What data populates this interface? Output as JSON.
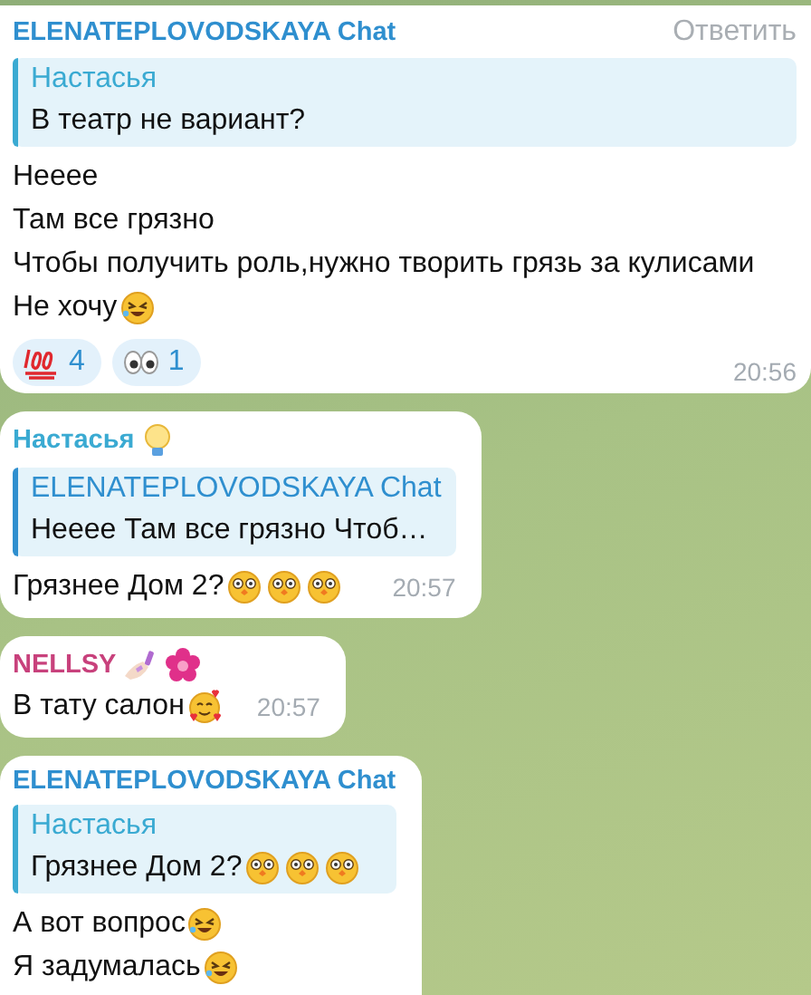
{
  "messages": [
    {
      "sender": "ELENATEPLOVODSKAYA Chat",
      "color": "#2f8fcf",
      "action": "Ответить",
      "quote": {
        "author": "Настасья",
        "color": "#3aaad2",
        "text": "В театр не вариант?"
      },
      "lines": [
        {
          "text": "Нееее"
        },
        {
          "text": "Там все грязно"
        },
        {
          "text": "Чтобы получить роль,нужно творить грязь за кулисами"
        },
        {
          "text": "Не хочу",
          "emoji": [
            {
              "kind": "rofl"
            }
          ]
        }
      ],
      "reactions": [
        {
          "kind": "hundred",
          "count": "4"
        },
        {
          "kind": "eyes",
          "count": "1"
        }
      ],
      "time": "20:56"
    },
    {
      "sender": "Настасья",
      "color": "#3aaad2",
      "badges": [
        {
          "kind": "bulb"
        }
      ],
      "quote": {
        "author": "ELENATEPLOVODSKAYA Chat",
        "color": "#2f8fcf",
        "text": "Нееее Там все грязно Чтоб…"
      },
      "lines": [
        {
          "text": "Грязнее Дом 2?",
          "emoji": [
            {
              "kind": "flushed"
            },
            {
              "kind": "flushed"
            },
            {
              "kind": "flushed"
            }
          ]
        }
      ],
      "time": "20:57"
    },
    {
      "sender": "NELLSY",
      "color": "#c8417c",
      "badges": [
        {
          "kind": "nail-polish"
        },
        {
          "kind": "flower"
        }
      ],
      "lines": [
        {
          "text": "В тату салон",
          "emoji": [
            {
              "kind": "hearts"
            }
          ]
        }
      ],
      "time": "20:57"
    },
    {
      "sender": "ELENATEPLOVODSKAYA Chat",
      "color": "#2f8fcf",
      "quote": {
        "author": "Настасья",
        "color": "#3aaad2",
        "text": "Грязнее Дом 2?",
        "emoji": [
          {
            "kind": "flushed"
          },
          {
            "kind": "flushed"
          },
          {
            "kind": "flushed"
          }
        ]
      },
      "lines": [
        {
          "text": "А вот вопрос",
          "emoji": [
            {
              "kind": "rofl"
            }
          ]
        },
        {
          "text": "Я задумалась",
          "emoji": [
            {
              "kind": "rofl"
            }
          ]
        }
      ]
    }
  ]
}
